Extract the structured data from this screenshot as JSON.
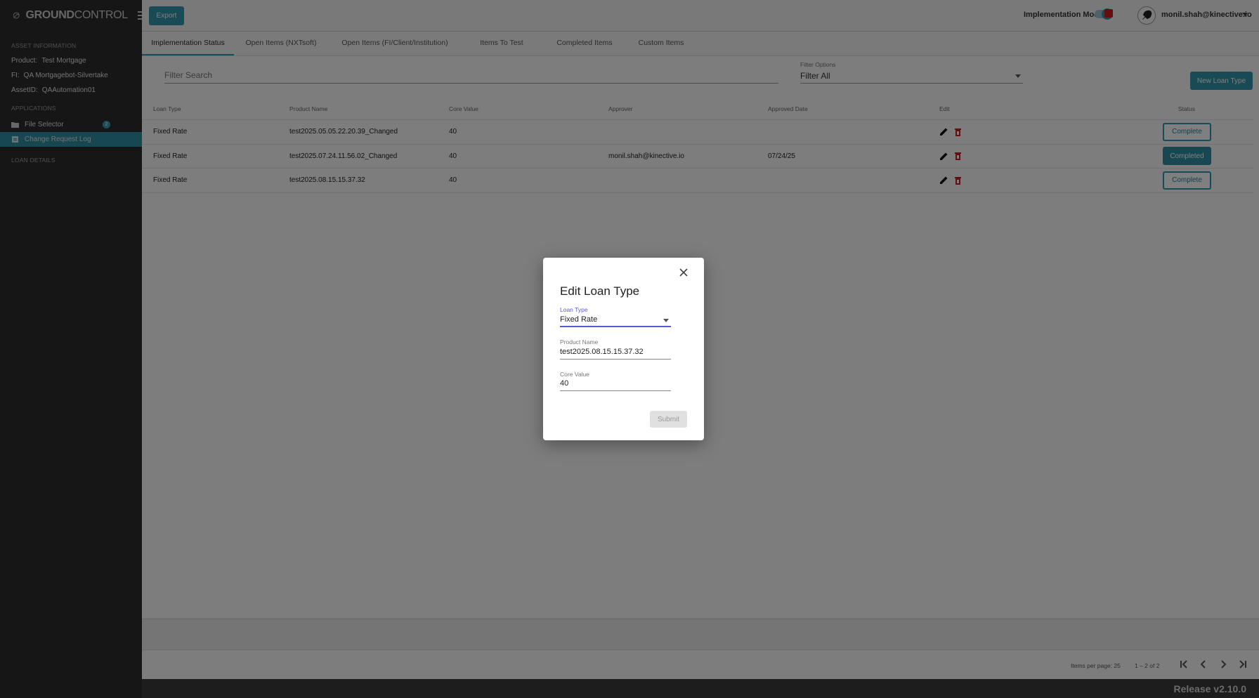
{
  "app": {
    "logo_bold": "GROUND",
    "logo_thin": "CONTROL"
  },
  "sidebar": {
    "asset_section": "ASSET INFORMATION",
    "product_key": "Product:",
    "product_val": "Test Mortgage",
    "fi_key": "FI:",
    "fi_val": "QA Mortgagebot-Silvertake",
    "asset_key": "AssetID:",
    "asset_val": "QAAutomation01",
    "apps_section": "APPLICATIONS",
    "items": [
      {
        "label": "File Selector",
        "badge": "2"
      },
      {
        "label": "Change Request Log"
      }
    ],
    "loan_section": "LOAN DETAILS"
  },
  "header": {
    "export_label": "Export",
    "impl_mode_label": "Implementation Mode",
    "user_email": "monil.shah@kinective.io"
  },
  "tabs": [
    "Implementation Status",
    "Open Items (NXTsoft)",
    "Open Items (FI/Client/Institution)",
    "Items To Test",
    "Completed Items",
    "Custom Items"
  ],
  "filters": {
    "search_placeholder": "Filter Search",
    "options_label": "Filter Options",
    "options_value": "Filter All",
    "new_button": "New Loan Type"
  },
  "table": {
    "headers": [
      "Loan Type",
      "Product Name",
      "Core Value",
      "Approver",
      "Approved Date",
      "Edit",
      "Status"
    ],
    "rows": [
      {
        "type": "Fixed Rate",
        "product": "test2025.05.05.22.20.39_Changed",
        "core": "40",
        "approver": "",
        "date": "",
        "status": "Complete"
      },
      {
        "type": "Fixed Rate",
        "product": "test2025.07.24.11.56.02_Changed",
        "core": "40",
        "approver": "monil.shah@kinective.io",
        "date": "07/24/25",
        "status": "Completed"
      },
      {
        "type": "Fixed Rate",
        "product": "test2025.08.15.15.37.32",
        "core": "40",
        "approver": "",
        "date": "",
        "status": "Complete"
      }
    ]
  },
  "pager": {
    "items_per_page": "Items per page: 25",
    "range": "1 – 2 of 2"
  },
  "release": "Release v2.10.0",
  "dialog": {
    "title": "Edit Loan Type",
    "loan_type_label": "Loan Type",
    "loan_type_value": "Fixed Rate",
    "product_label": "Product Name",
    "product_value": "test2025.08.15.15.37.32",
    "core_label": "Core Value",
    "core_value": "40",
    "submit": "Submit"
  },
  "colors": {
    "accent": "#3196aa",
    "focus": "#5a5ad6",
    "delete": "#c81e1e",
    "sidebar": "#2c2c2c"
  }
}
